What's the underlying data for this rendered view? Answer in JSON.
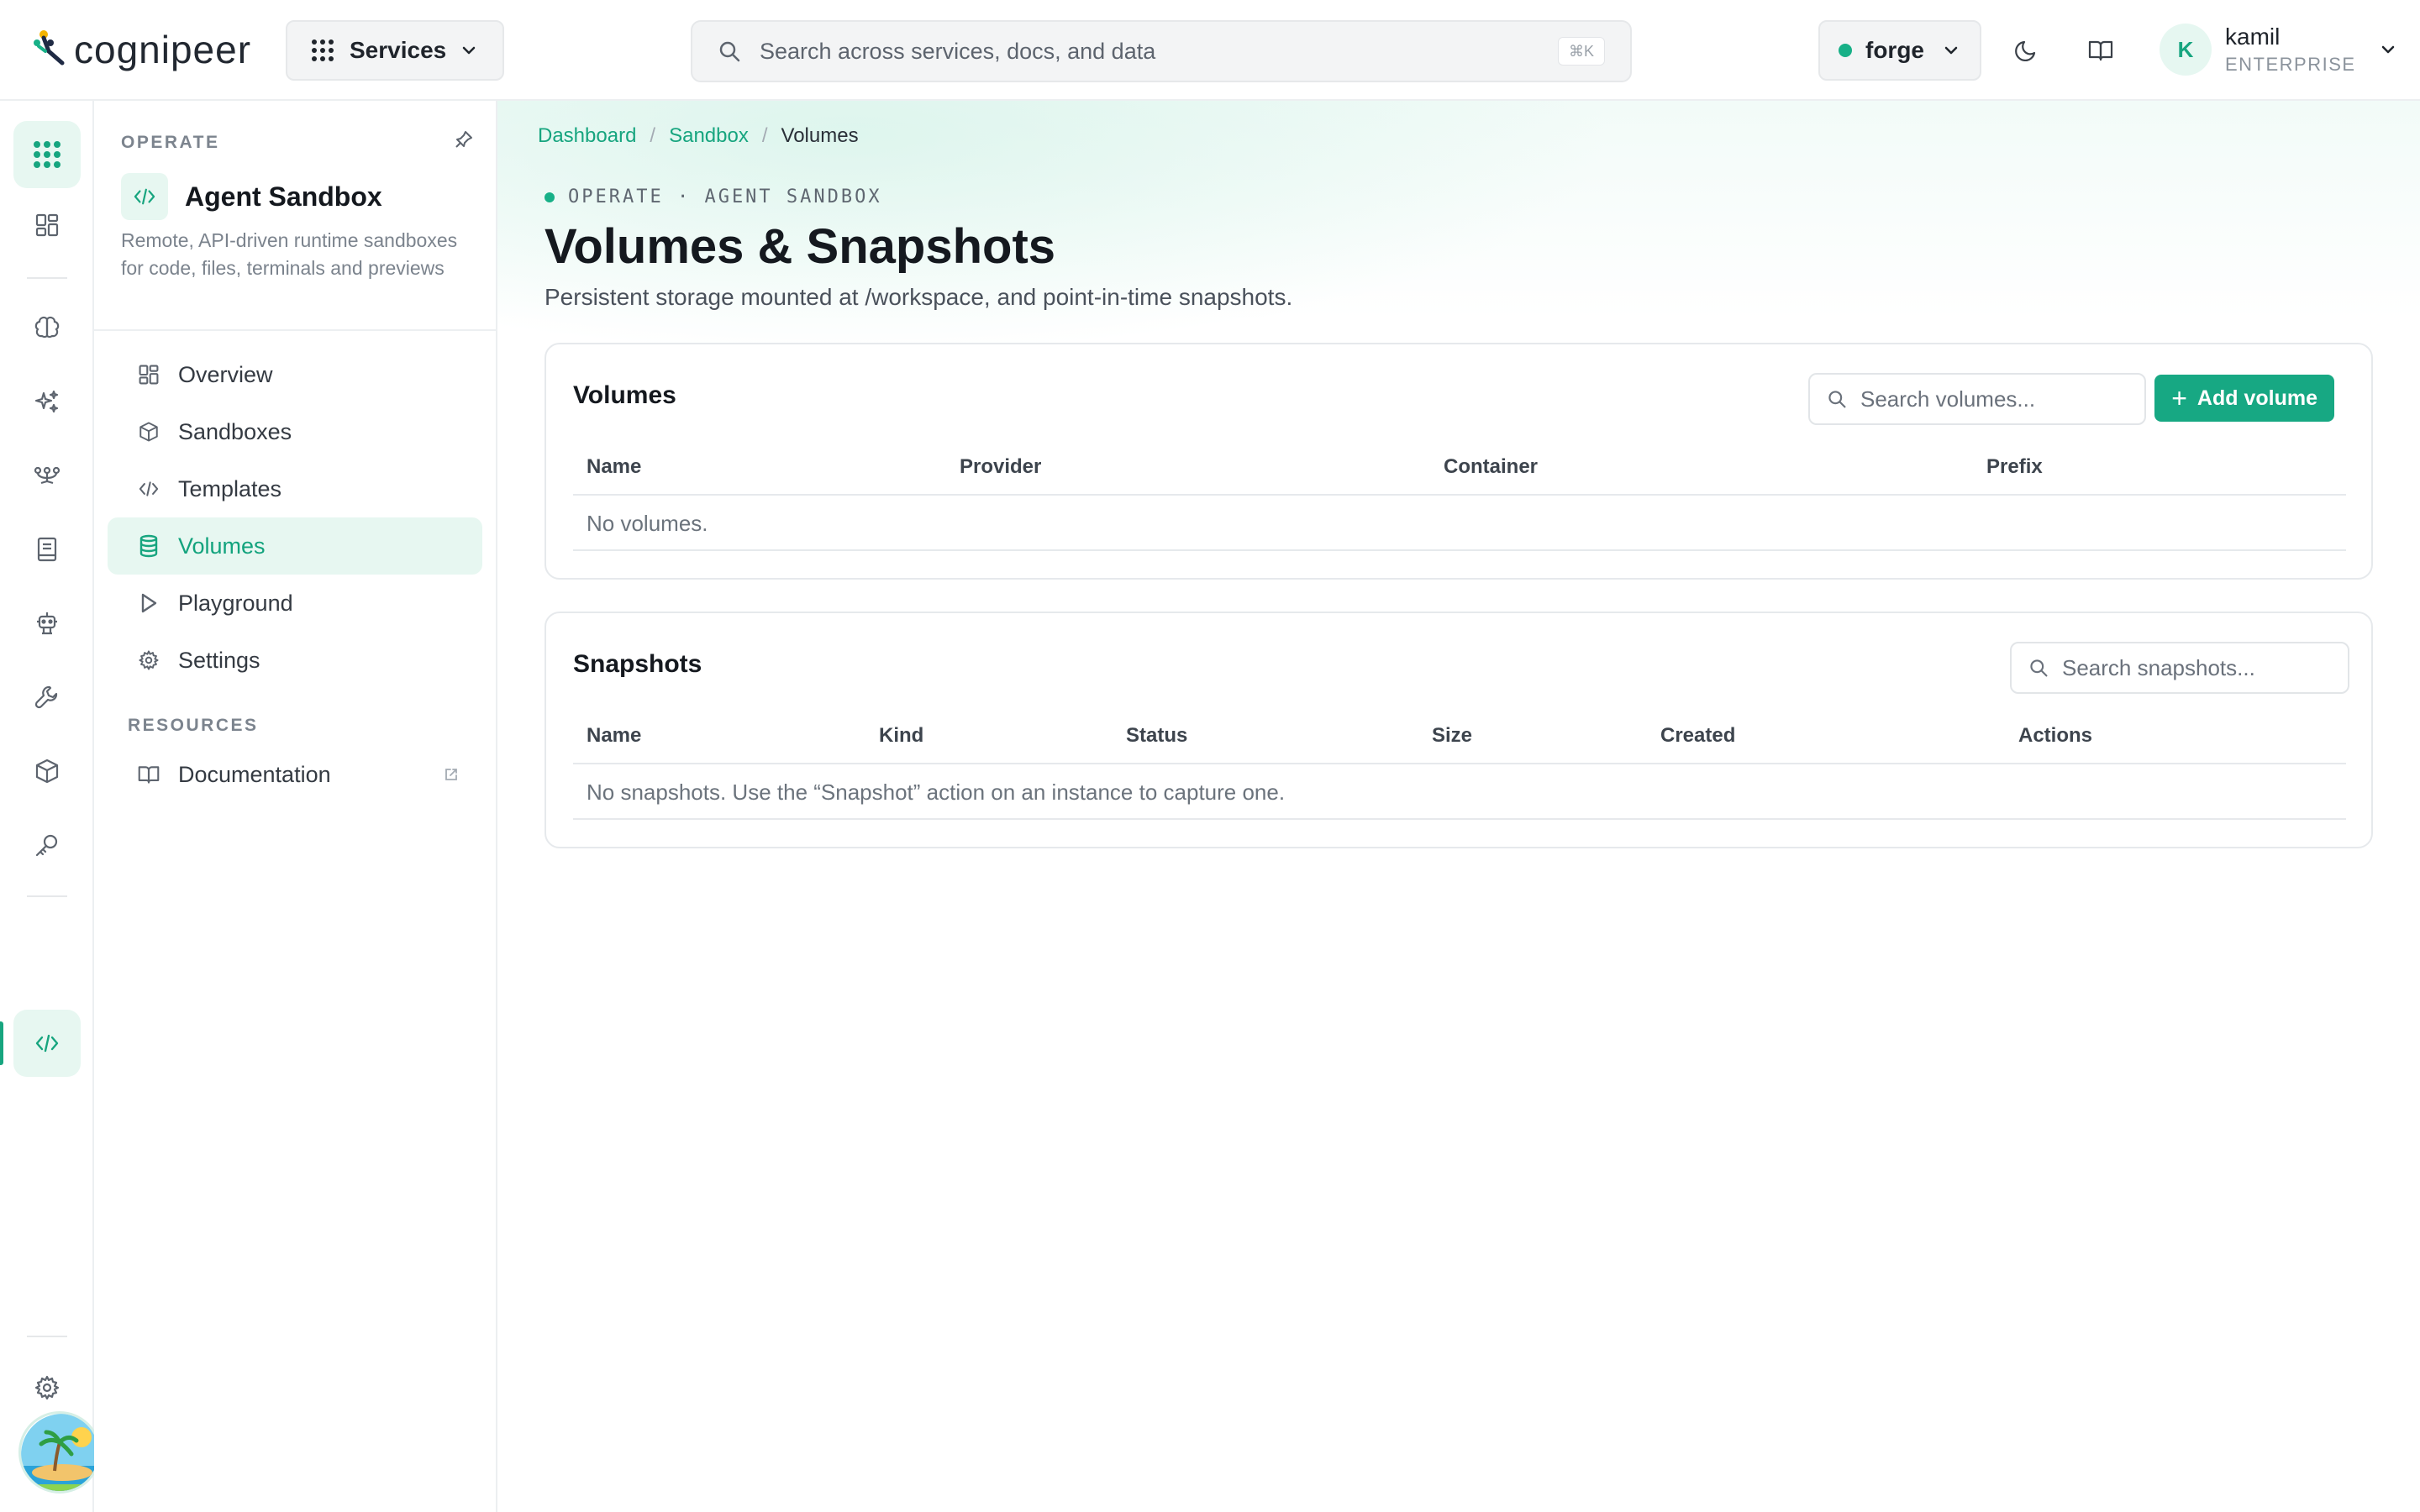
{
  "header": {
    "logo_text": "cognipeer",
    "services_label": "Services",
    "search": {
      "placeholder": "Search across services, docs, and data",
      "shortcut": "⌘K"
    },
    "workspace": {
      "name": "forge",
      "status_color": "#17b087"
    },
    "user": {
      "initial": "K",
      "name": "kamil",
      "plan": "ENTERPRISE"
    }
  },
  "rail": {
    "items": [
      {
        "icon": "apps-grid-icon",
        "active": true
      },
      {
        "icon": "dashboard-icon"
      },
      {
        "icon": "brain-icon"
      },
      {
        "icon": "sparkles-icon"
      },
      {
        "icon": "flow-icon"
      },
      {
        "icon": "book-icon"
      },
      {
        "icon": "robot-icon"
      },
      {
        "icon": "wrench-icon"
      },
      {
        "icon": "cube-icon"
      },
      {
        "icon": "key-icon"
      },
      {
        "icon": "code-icon",
        "active": true
      },
      {
        "icon": "gear-icon"
      }
    ]
  },
  "sidebar": {
    "section": "OPERATE",
    "title": "Agent Sandbox",
    "description": "Remote, API-driven runtime sandboxes for code, files, terminals and previews",
    "nav": [
      {
        "label": "Overview",
        "icon": "dashboard-icon"
      },
      {
        "label": "Sandboxes",
        "icon": "cube-icon"
      },
      {
        "label": "Templates",
        "icon": "code-icon"
      },
      {
        "label": "Volumes",
        "icon": "database-icon",
        "active": true
      },
      {
        "label": "Playground",
        "icon": "play-icon"
      },
      {
        "label": "Settings",
        "icon": "gear-icon"
      }
    ],
    "resources_label": "RESOURCES",
    "resources": [
      {
        "label": "Documentation",
        "icon": "book-open-icon"
      }
    ]
  },
  "main": {
    "breadcrumb": [
      "Dashboard",
      "Sandbox",
      "Volumes"
    ],
    "eyebrow": "OPERATE · AGENT SANDBOX",
    "title": "Volumes & Snapshots",
    "subtitle": "Persistent storage mounted at /workspace, and point-in-time snapshots.",
    "volumes": {
      "title": "Volumes",
      "search_placeholder": "Search volumes...",
      "add_label": "Add volume",
      "columns": [
        "Name",
        "Provider",
        "Container",
        "Prefix"
      ],
      "empty": "No volumes."
    },
    "snapshots": {
      "title": "Snapshots",
      "search_placeholder": "Search snapshots...",
      "columns": [
        "Name",
        "Kind",
        "Status",
        "Size",
        "Created",
        "Actions"
      ],
      "empty": "No snapshots. Use the “Snapshot” action on an instance to capture one."
    }
  },
  "colors": {
    "accent": "#17a57f",
    "accent_bg": "#e7f7f1",
    "button": "#17a883"
  }
}
